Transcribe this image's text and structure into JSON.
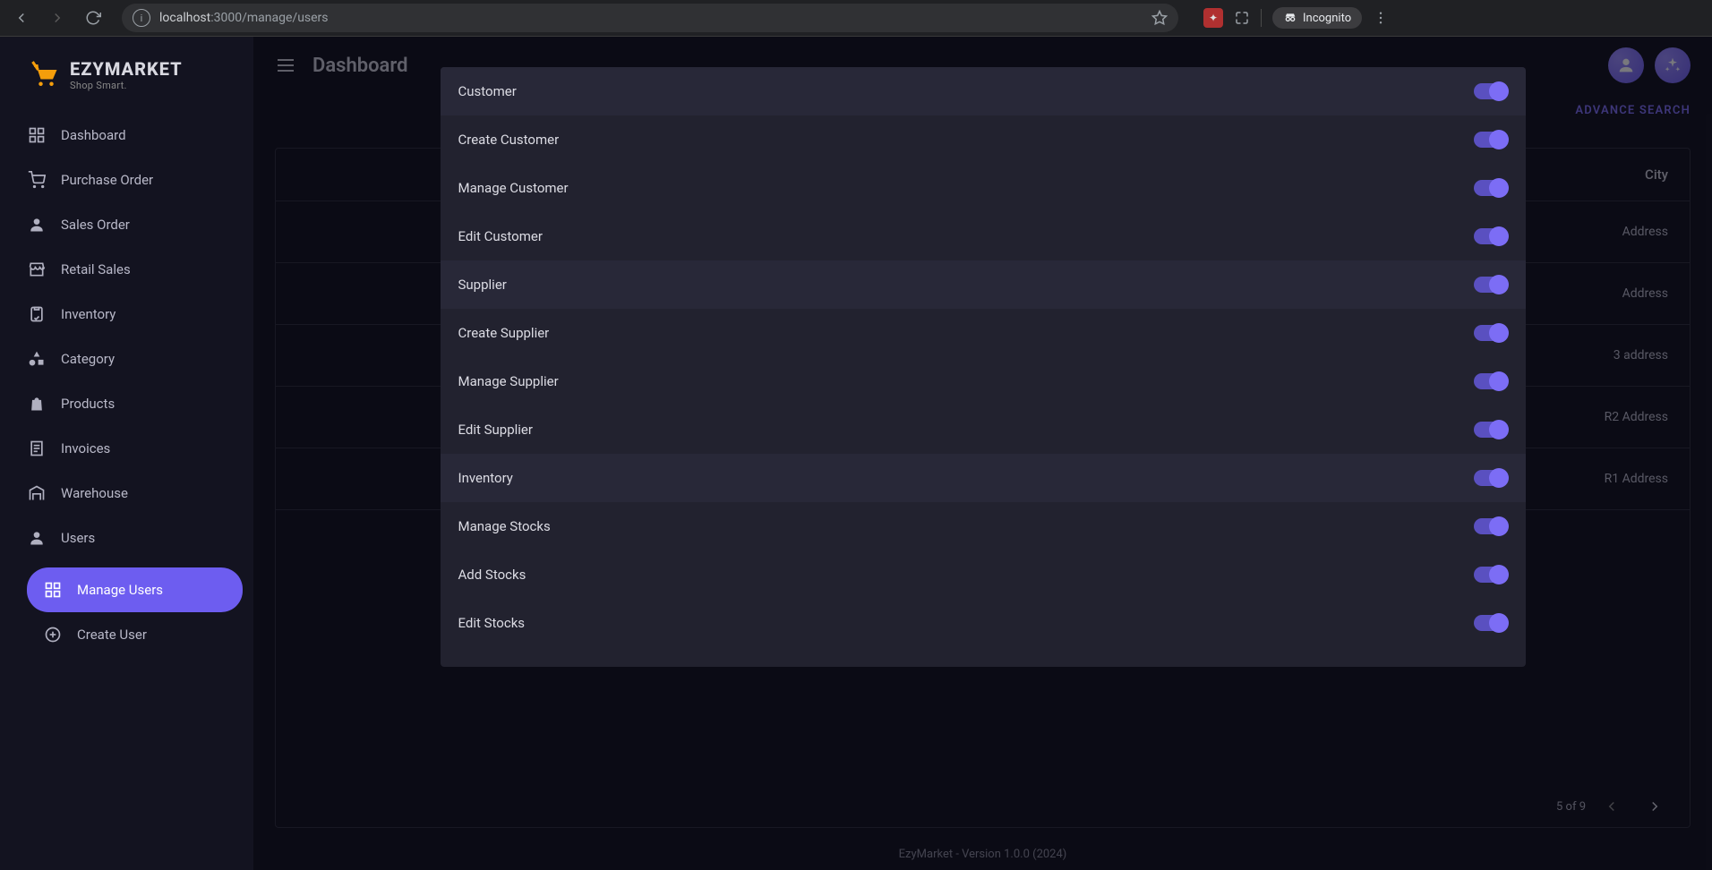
{
  "browser": {
    "url_host": "localhost",
    "url_path": ":3000/manage/users",
    "incognito_label": "Incognito"
  },
  "brand": {
    "name": "EZYMARKET",
    "tagline": "Shop Smart."
  },
  "sidebar": {
    "items": [
      {
        "label": "Dashboard",
        "icon": "dashboard"
      },
      {
        "label": "Purchase Order",
        "icon": "cart"
      },
      {
        "label": "Sales Order",
        "icon": "account"
      },
      {
        "label": "Retail Sales",
        "icon": "store"
      },
      {
        "label": "Inventory",
        "icon": "clipboard"
      },
      {
        "label": "Category",
        "icon": "shapes"
      },
      {
        "label": "Products",
        "icon": "bag"
      },
      {
        "label": "Invoices",
        "icon": "receipt"
      },
      {
        "label": "Warehouse",
        "icon": "warehouse"
      },
      {
        "label": "Users",
        "icon": "account"
      }
    ],
    "sub_items": [
      {
        "label": "Manage Users",
        "icon": "dashboard",
        "active": true
      },
      {
        "label": "Create User",
        "icon": "plus-circle"
      }
    ]
  },
  "header": {
    "title": "Dashboard",
    "advance_search": "ADVANCE SEARCH"
  },
  "permissions": [
    {
      "label": "Customer",
      "group": true,
      "on": true
    },
    {
      "label": "Create Customer",
      "group": false,
      "on": true
    },
    {
      "label": "Manage Customer",
      "group": false,
      "on": true
    },
    {
      "label": "Edit Customer",
      "group": false,
      "on": true
    },
    {
      "label": "Supplier",
      "group": true,
      "on": true
    },
    {
      "label": "Create Supplier",
      "group": false,
      "on": true
    },
    {
      "label": "Manage Supplier",
      "group": false,
      "on": true
    },
    {
      "label": "Edit Supplier",
      "group": false,
      "on": true
    },
    {
      "label": "Inventory",
      "group": true,
      "on": true
    },
    {
      "label": "Manage Stocks",
      "group": false,
      "on": true
    },
    {
      "label": "Add Stocks",
      "group": false,
      "on": true
    },
    {
      "label": "Edit Stocks",
      "group": false,
      "on": true
    }
  ],
  "table": {
    "column_city": "City",
    "rows": [
      {
        "address": "Address"
      },
      {
        "address": "Address"
      },
      {
        "address": "3 address"
      },
      {
        "address": "R2 Address"
      },
      {
        "address": "R1 Address"
      }
    ],
    "pagination_label": "5 of 9"
  },
  "footer": {
    "text": "EzyMarket - Version 1.0.0 (2024)"
  }
}
